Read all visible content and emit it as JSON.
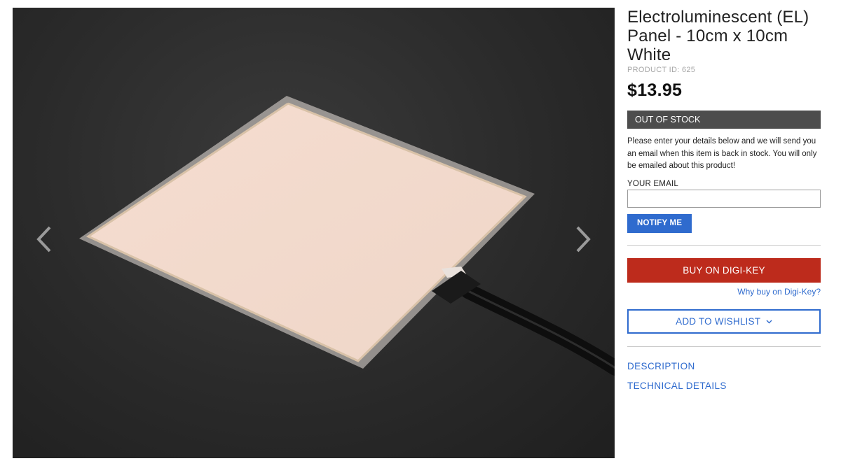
{
  "gallery": {
    "prev_icon": "chevron-left-icon",
    "next_icon": "chevron-right-icon",
    "image_subject": "el-panel-photo"
  },
  "product": {
    "title": "Electroluminescent (EL) Panel - 10cm x 10cm White",
    "product_id": "PRODUCT ID: 625",
    "price": "$13.95",
    "stock_status": "OUT OF STOCK",
    "notice": "Please enter your details below and we will send you an email when this item is back in stock. You will only be emailed about this product!",
    "email_label": "YOUR EMAIL",
    "email_value": "",
    "notify_label": "NOTIFY ME",
    "buy_label": "BUY ON DIGI-KEY",
    "why_label": "Why buy on Digi-Key?",
    "wishlist_label": "ADD TO WISHLIST",
    "description_label": "DESCRIPTION",
    "technical_label": "TECHNICAL DETAILS"
  },
  "colors": {
    "accent_blue": "#2f6bce",
    "buy_red": "#bd2b1c",
    "stock_gray": "#4d4d4d"
  }
}
